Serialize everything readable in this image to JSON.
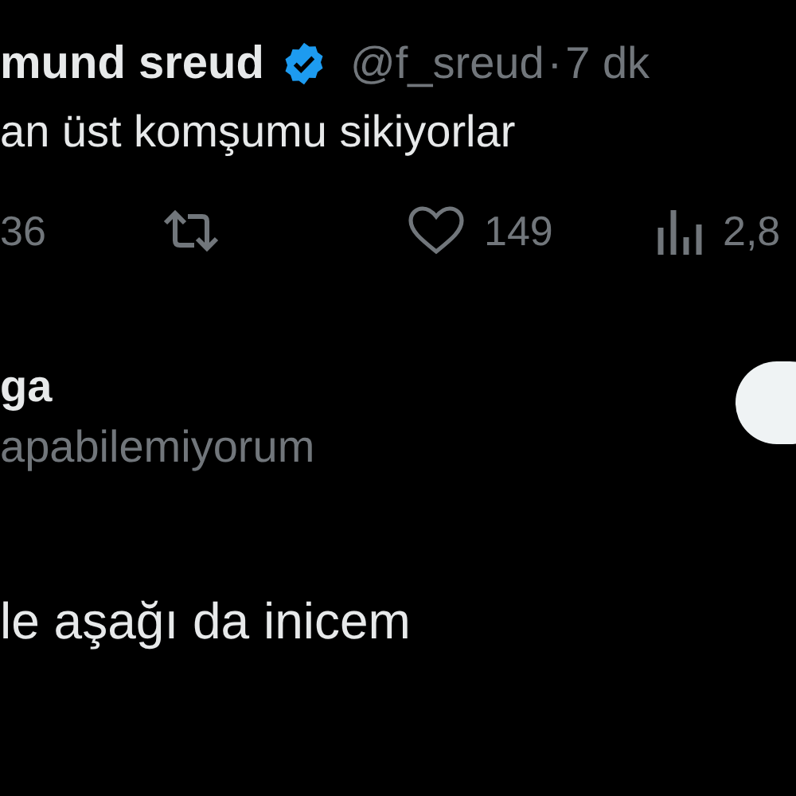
{
  "tweet": {
    "name": "mund sreud",
    "verified": true,
    "handle": "@f_sreud",
    "separator": "·",
    "time": "7 dk",
    "text": "an üst komşumu sikiyorlar",
    "actions": [
      {
        "kind": "reply",
        "count": "36"
      },
      {
        "kind": "retweet"
      },
      {
        "kind": "like",
        "count": "149"
      },
      {
        "kind": "views",
        "count": "2,8"
      }
    ]
  },
  "profile": {
    "name": "ga",
    "bio": "apabilemiyorum",
    "follow_button": true
  },
  "reply": {
    "text": "le aşağı da inicem"
  }
}
